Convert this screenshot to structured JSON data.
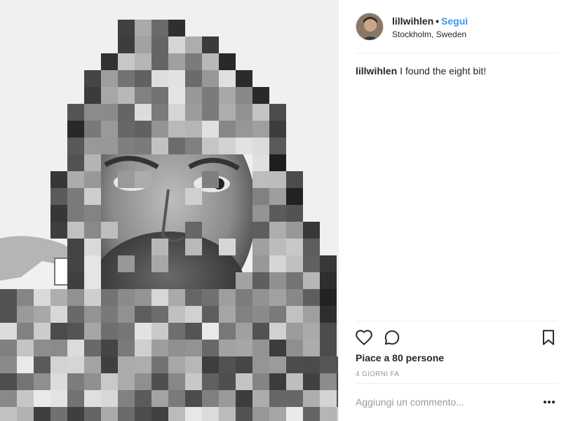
{
  "post": {
    "image_alt": "Pixelated black and white portrait of a bearded man holding a small square"
  },
  "header": {
    "username": "lillwihlen",
    "separator": "•",
    "follow_label": "Segui",
    "location": "Stockholm, Sweden"
  },
  "caption": {
    "username": "lillwihlen",
    "text": "I found the eight bit!"
  },
  "actions": {
    "like_icon": "heart-outline-icon",
    "comment_icon": "comment-bubble-icon",
    "save_icon": "bookmark-icon"
  },
  "likes": {
    "text": "Piace a 80 persone"
  },
  "timestamp": "4 GIORNI FA",
  "comment": {
    "placeholder": "Aggiungi un commento...",
    "more_icon": "ellipsis-icon"
  },
  "colors": {
    "accent": "#3897f0",
    "text": "#262626",
    "muted": "#999999",
    "divider": "#efefef"
  }
}
